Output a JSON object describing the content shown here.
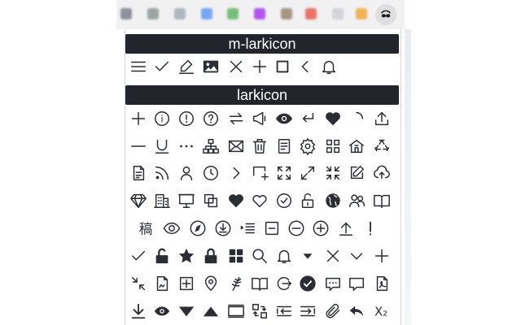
{
  "browser": {
    "extensions": [
      {
        "name": "extension-icon",
        "color": "#6b7280"
      },
      {
        "name": "extension-icon",
        "color": "#7f8c8d"
      },
      {
        "name": "extension-icon",
        "color": "#9aa3ad"
      },
      {
        "name": "extension-icon",
        "color": "#4f8ff7"
      },
      {
        "name": "extension-icon",
        "color": "#4caf50"
      },
      {
        "name": "extension-icon",
        "color": "#a020f0"
      },
      {
        "name": "extension-icon",
        "color": "#8a7a5a"
      },
      {
        "name": "extension-icon",
        "color": "#e74c3c"
      },
      {
        "name": "extension-icon",
        "color": "#c8cbd0"
      },
      {
        "name": "extension-icon",
        "color": "#f0a020"
      }
    ],
    "active_extension": "larkicon-extension-icon"
  },
  "sections": {
    "m_larkicon": {
      "title": "m-larkicon",
      "icons": [
        "menu",
        "check",
        "edit",
        "image",
        "close",
        "plus",
        "square",
        "chevron-left",
        "bell"
      ]
    },
    "larkicon": {
      "title": "larkicon",
      "rows": [
        [
          "plus",
          "info-circle",
          "alert-circle",
          "question-circle",
          "swap",
          "megaphone",
          "eye-filled",
          "enter",
          "heart-filled",
          "loading",
          "upload"
        ],
        [
          "minus",
          "underline",
          "ellipsis",
          "org-chart",
          "mail",
          "trash",
          "file-list",
          "settings",
          "apps",
          "home-alt",
          "recycle"
        ],
        [
          "file-text",
          "rss",
          "user",
          "clock",
          "chevron-right",
          "add-frame",
          "expand",
          "arrows-diagonal",
          "compress",
          "edit-square",
          "cloud-upload"
        ],
        [
          "diamond",
          "building",
          "presentation",
          "copy",
          "heart-filled",
          "heart-outline",
          "check-circle",
          "unlock",
          "globe",
          "team",
          "book"
        ],
        [
          "hanzi-draft",
          "eye-outline",
          "compass",
          "download-circle",
          "indent",
          "minus-square",
          "minus-circle",
          "plus-circle",
          "arrow-up-bar",
          "exclamation"
        ],
        [
          "check",
          "unlock-filled",
          "star",
          "lock-filled",
          "apps-filled",
          "search",
          "bell",
          "caret-down",
          "close",
          "chevron-down",
          "plus"
        ],
        [
          "shrink",
          "file-sign",
          "plus-square",
          "location",
          "wheat",
          "book-open",
          "logout",
          "check-circle-filled",
          "comment-dots",
          "comment",
          "pdf"
        ],
        [
          "download-bar",
          "eye-small",
          "triangle-down",
          "triangle-up",
          "panel",
          "transfer",
          "arrow-in-left",
          "arrow-in-right",
          "paperclip",
          "reply",
          "subscript"
        ]
      ],
      "glyph_text": {
        "hanzi-draft": "稿",
        "subscript": "X₂"
      }
    }
  }
}
